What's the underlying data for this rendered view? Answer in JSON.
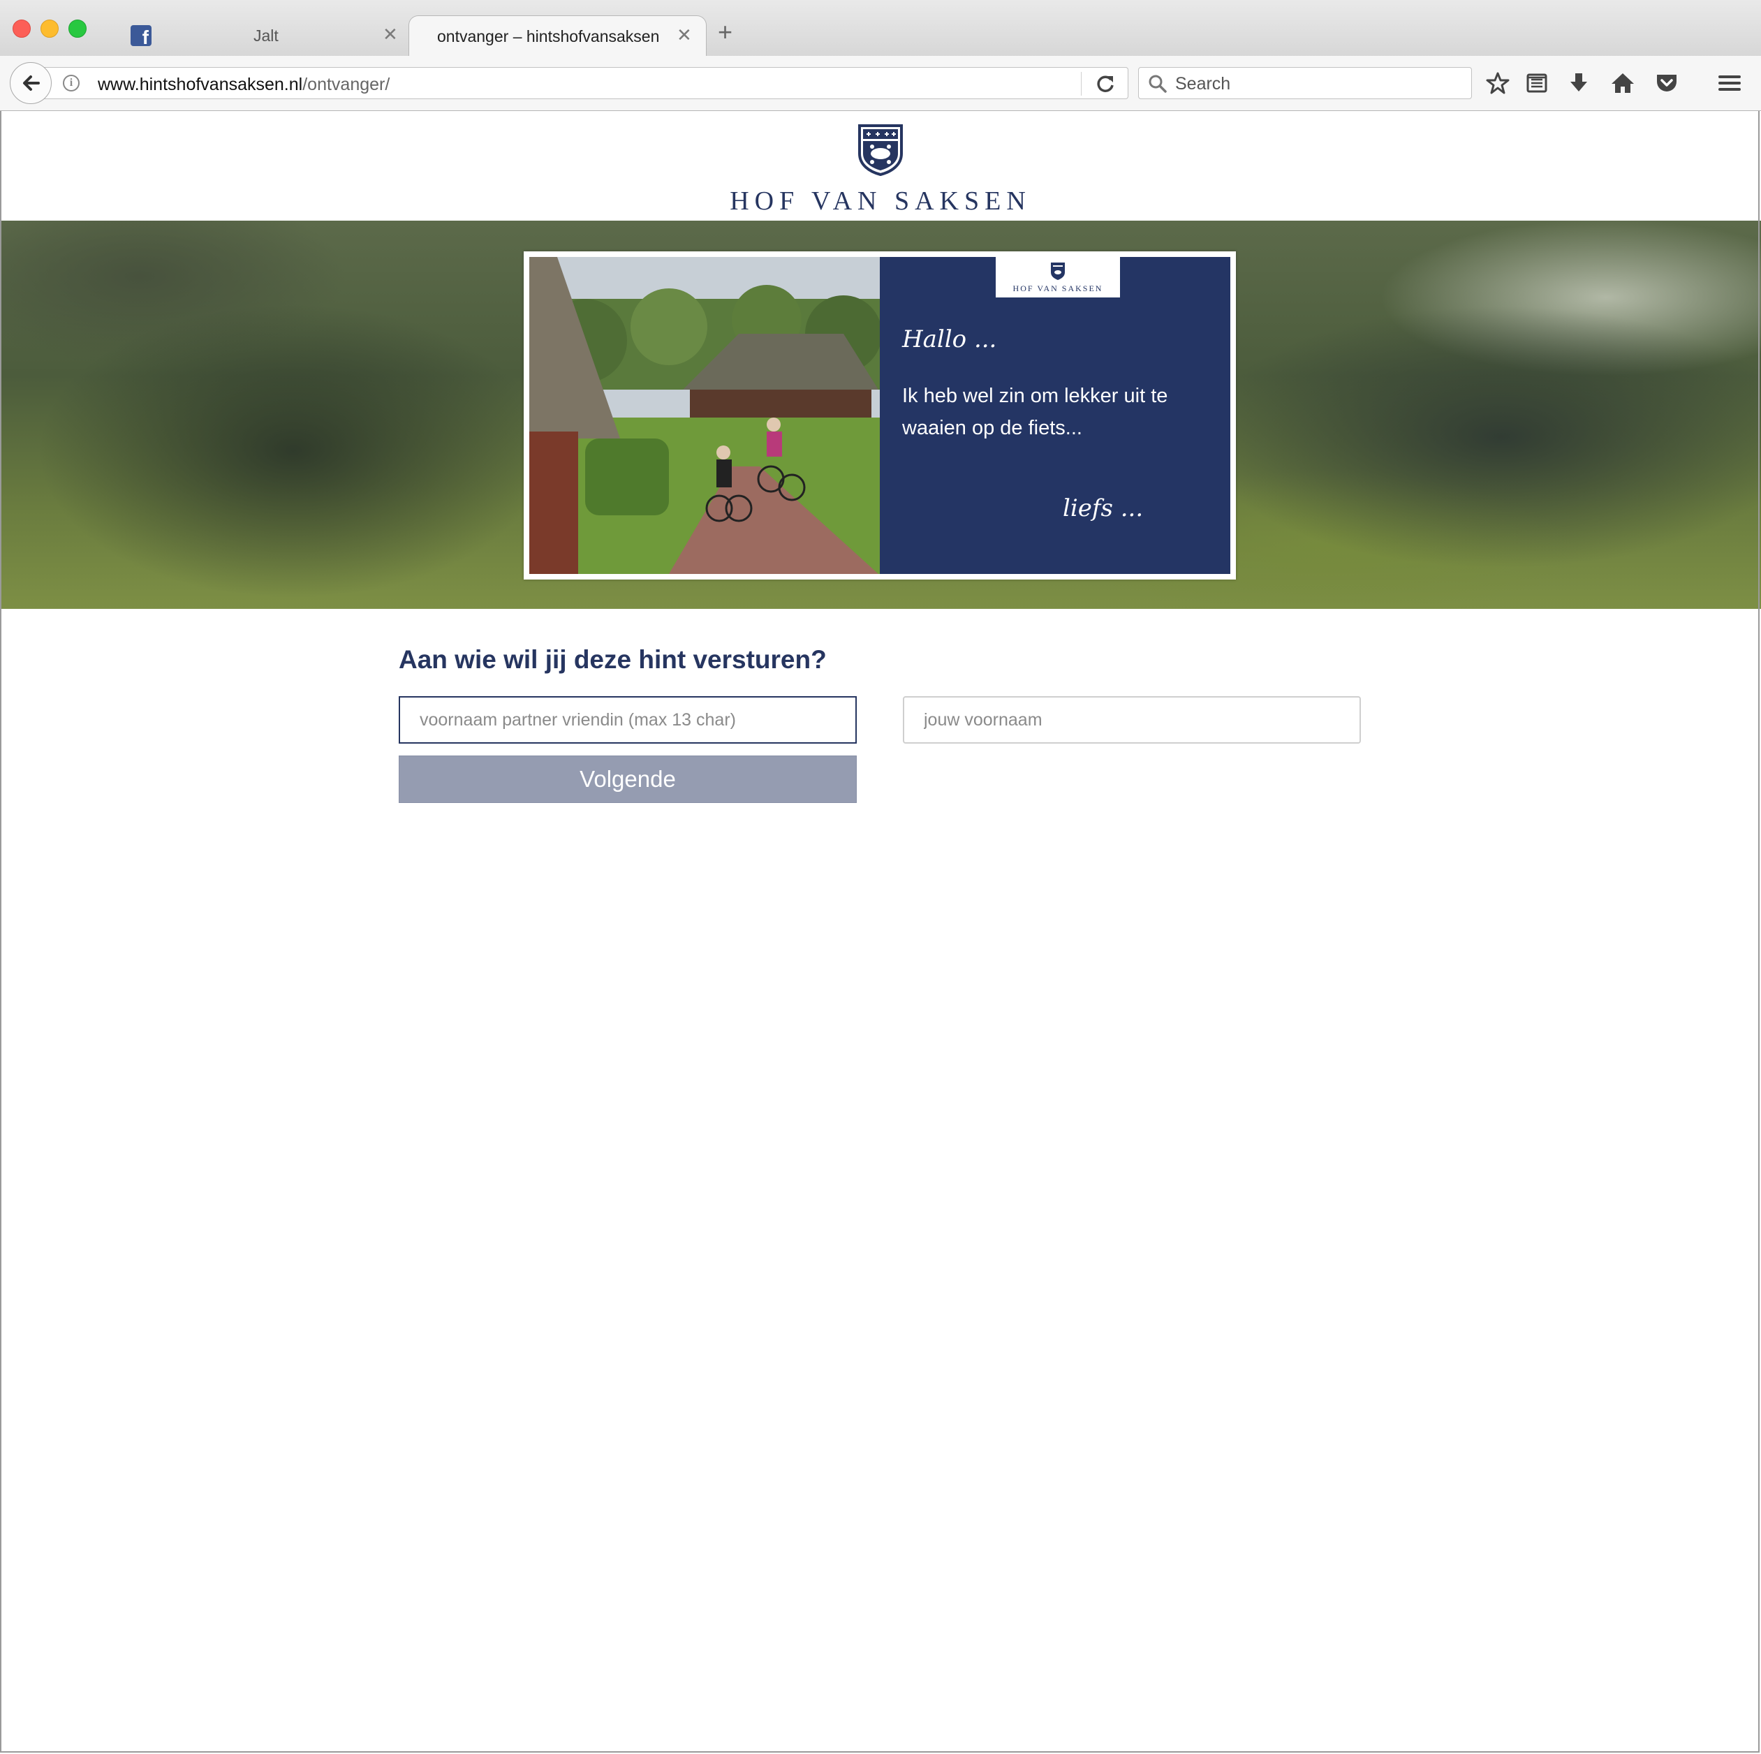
{
  "browser": {
    "tabs": [
      {
        "title": "Jalt",
        "icon": "facebook-icon",
        "active": false
      },
      {
        "title": "ontvanger – hintshofvansaksen",
        "active": true
      }
    ],
    "url": {
      "host": "www.hintshofvansaksen.nl",
      "path": "/ontvanger/"
    },
    "search_placeholder": "Search"
  },
  "header": {
    "brand": "HOF VAN SAKSEN"
  },
  "card": {
    "mini_brand": "HOF VAN SAKSEN",
    "greeting": "Hallo ...",
    "message": "Ik heb wel zin om lekker uit te waaien op de fiets...",
    "signoff": "liefs ..."
  },
  "form": {
    "heading": "Aan wie wil jij deze hint versturen?",
    "recipient_placeholder": "voornaam partner vriendin (max 13 char)",
    "sender_placeholder": "jouw voornaam",
    "next_label": "Volgende"
  },
  "colors": {
    "brand_navy": "#243564",
    "button_gray": "#959cb1"
  }
}
